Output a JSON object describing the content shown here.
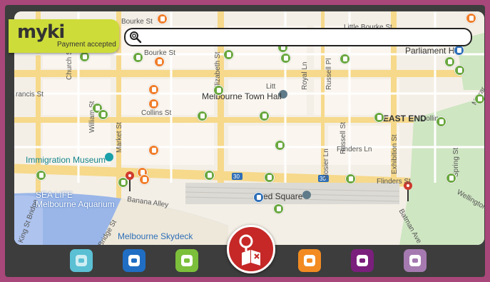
{
  "app": {
    "brand": "myki",
    "status": "Payment accepted"
  },
  "search": {
    "value": "",
    "placeholder": "",
    "icon": "search-icon"
  },
  "map": {
    "streets": [
      "Bourke St",
      "Little Bourke St",
      "Bourke St",
      "Collins St",
      "Flinders St",
      "Flinders Ln",
      "Market St",
      "William St",
      "Elizabeth St",
      "Russell St",
      "Russell Pl",
      "Royal Ln",
      "Hosier Ln",
      "Exhibition St",
      "Spring St",
      "Church St",
      "Banana Alley",
      "Batman Ave",
      "King St Bridge",
      "Bridge St",
      "Wellington",
      "Macar",
      "Collins",
      "Litt",
      "rancis St",
      "Swanston"
    ],
    "places": {
      "town_hall": "Melbourne Town Hall",
      "east_end": "EAST END",
      "immigration_museum": "Immigration Museum",
      "sea_life": "SEA LIFE\nMelbourne Aquarium",
      "sea_life_1": "SEA LIFE",
      "sea_life_2": "Melbourne Aquarium",
      "fed_square": "ed Square",
      "skydeck": "Melbourne Skydeck",
      "parliament": "Parliament H"
    },
    "route_badges": [
      "30",
      "30"
    ]
  },
  "toolbar": {
    "items": [
      {
        "name": "train-mode-button",
        "color": "#5bc0d4"
      },
      {
        "name": "metro-mode-button",
        "color": "#1f6ec4"
      },
      {
        "name": "tram-mode-button",
        "color": "#7cbf3a"
      },
      {
        "name": "bus-mode-button",
        "color": "#f28b22"
      },
      {
        "name": "regional-mode-button",
        "color": "#7b1f7c"
      },
      {
        "name": "coach-mode-button",
        "color": "#a57ab0"
      }
    ],
    "center_icon": "nearby-stops-icon"
  }
}
